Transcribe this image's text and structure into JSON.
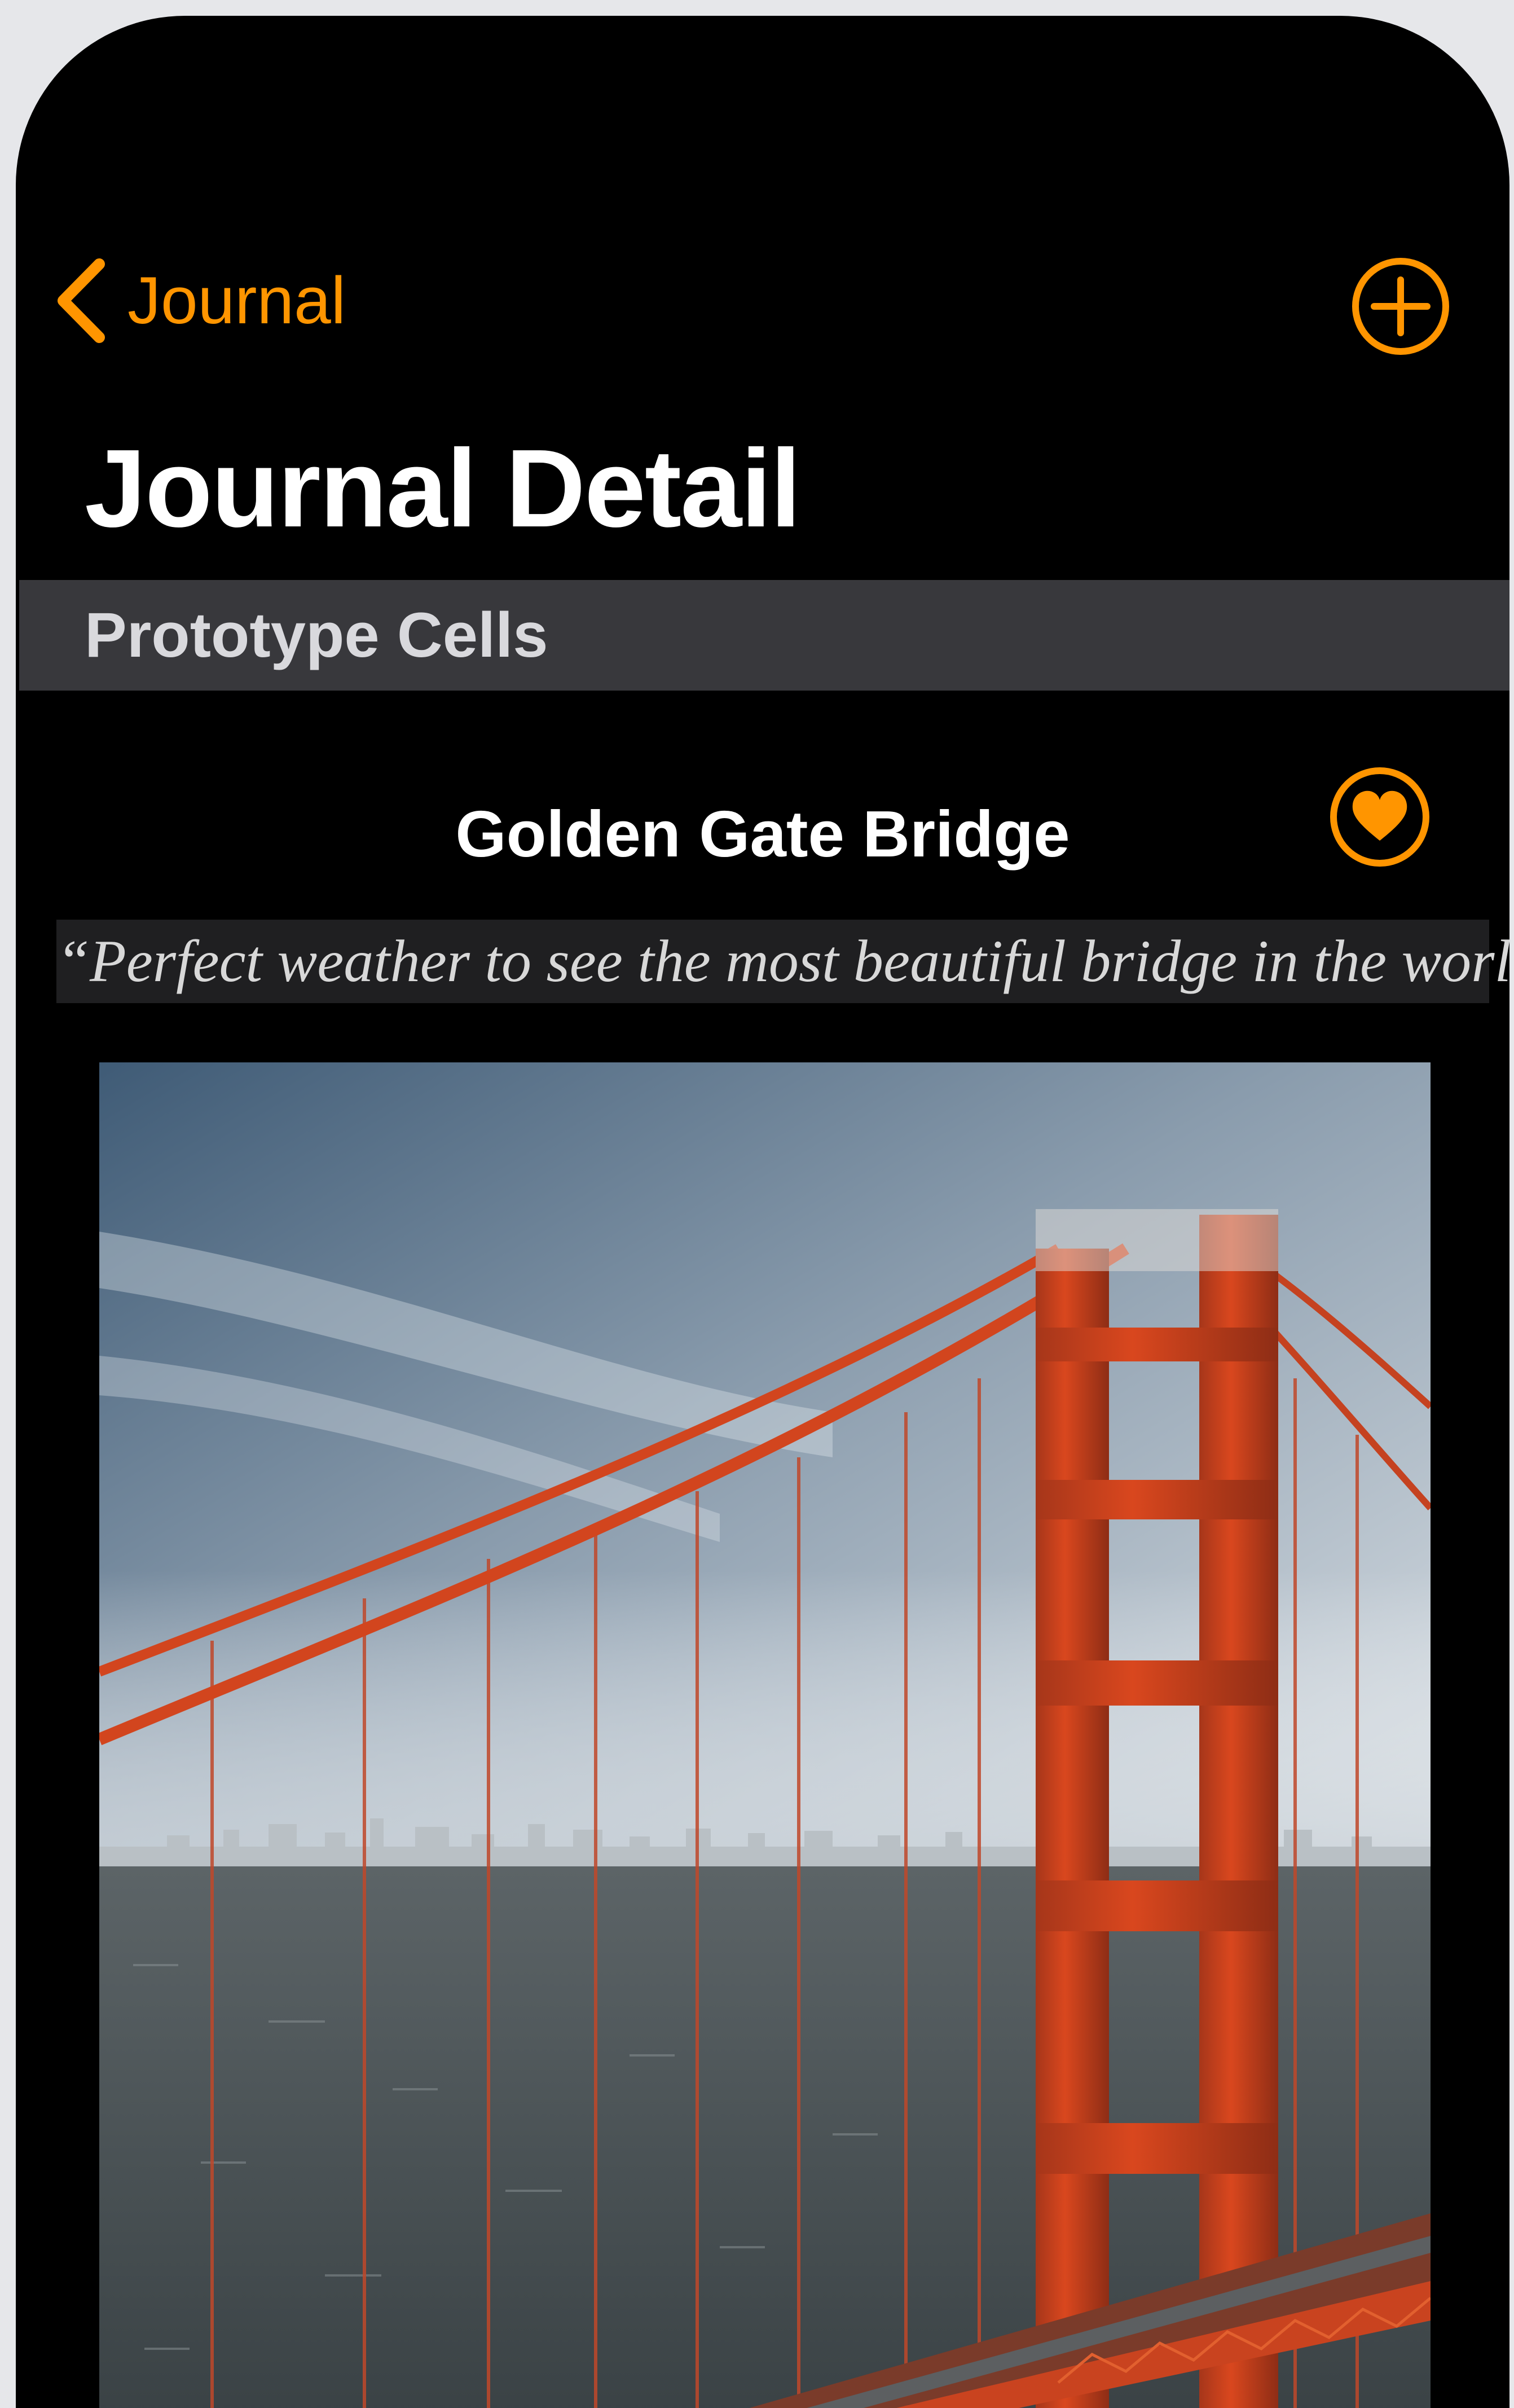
{
  "nav": {
    "back_label": "Journal",
    "back_icon": "chevron-left-icon",
    "add_icon": "plus-circle-icon"
  },
  "page": {
    "title": "Journal Detail"
  },
  "section": {
    "header": "Prototype Cells"
  },
  "entry": {
    "title": "Golden Gate Bridge",
    "quote": "“Perfect weather to see the most beautiful bridge in the world”",
    "favorite_icon": "heart-circle-icon",
    "photo_subject": "golden-gate-bridge-photo"
  },
  "colors": {
    "accent": "#ff9500",
    "background": "#000000",
    "section_header": "#38383c",
    "text_primary": "#ffffff",
    "bridge_red": "#d2451e"
  }
}
